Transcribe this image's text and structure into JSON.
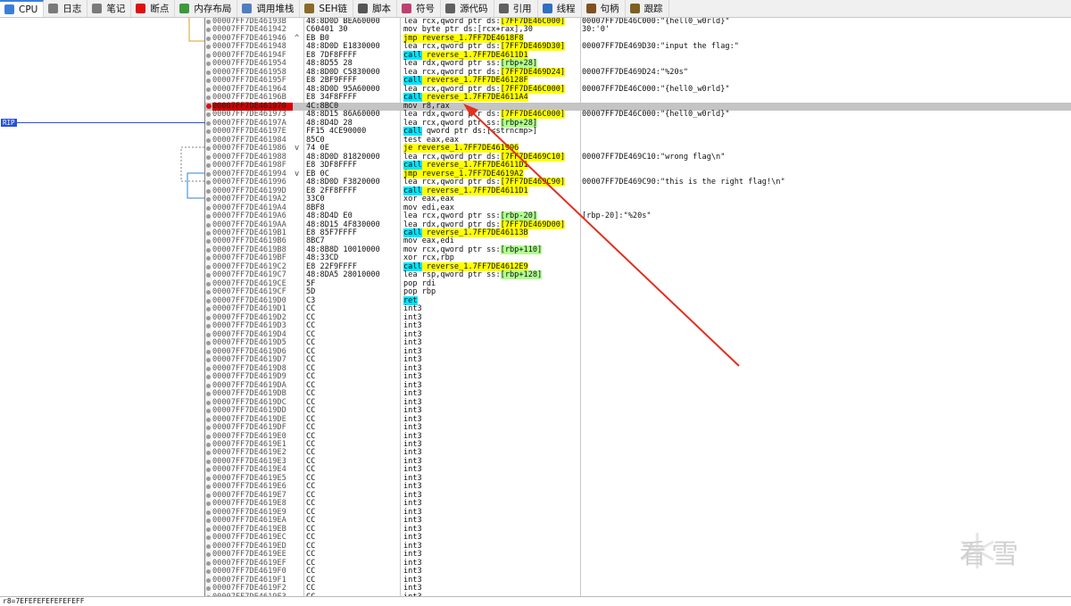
{
  "tabs": [
    {
      "label": "CPU",
      "icon": "cpu-icon",
      "color": "#3c7fd8",
      "active": true
    },
    {
      "label": "日志",
      "icon": "log-icon",
      "color": "#7a7a7a"
    },
    {
      "label": "笔记",
      "icon": "notes-icon",
      "color": "#7a7a7a"
    },
    {
      "label": "断点",
      "icon": "breakpoint-icon",
      "color": "#e01010"
    },
    {
      "label": "内存布局",
      "icon": "memory-map-icon",
      "color": "#3c9a3c"
    },
    {
      "label": "调用堆栈",
      "icon": "call-stack-icon",
      "color": "#4f7fc0"
    },
    {
      "label": "SEH链",
      "icon": "seh-chain-icon",
      "color": "#8a6a2a"
    },
    {
      "label": "脚本",
      "icon": "script-icon",
      "color": "#555555"
    },
    {
      "label": "符号",
      "icon": "symbols-icon",
      "color": "#c04070"
    },
    {
      "label": "源代码",
      "icon": "source-icon",
      "color": "#606060"
    },
    {
      "label": "引用",
      "icon": "references-icon",
      "color": "#606060"
    },
    {
      "label": "线程",
      "icon": "threads-icon",
      "color": "#3070c0"
    },
    {
      "label": "句柄",
      "icon": "handles-icon",
      "color": "#805020"
    },
    {
      "label": "跟踪",
      "icon": "trace-icon",
      "color": "#806020"
    }
  ],
  "rip_label": "RIP",
  "rows": [
    {
      "addr": "00007FF7DE46193B",
      "bytes": "48:8D0D BEA60000",
      "mark": "",
      "instr": [
        [
          "lea rcx,qword ptr ds:",
          ""
        ],
        [
          "[7FF7DE46C000]",
          "y"
        ]
      ],
      "cmt": "00007FF7DE46C000:\"{hell0_w0rld}\""
    },
    {
      "addr": "00007FF7DE461942",
      "bytes": "C60401 30",
      "mark": "",
      "instr": [
        [
          "mov byte ptr ds:[rcx+rax],30",
          ""
        ]
      ],
      "cmt": "30:'0'"
    },
    {
      "addr": "00007FF7DE461946",
      "bytes": "EB B0",
      "mark": "^",
      "instr": [
        [
          "jmp reverse_1.7FF7DE4618F8",
          "y"
        ]
      ],
      "cmt": ""
    },
    {
      "addr": "00007FF7DE461948",
      "bytes": "48:8D0D E1830000",
      "mark": "",
      "instr": [
        [
          "lea rcx,qword ptr ds:",
          ""
        ],
        [
          "[7FF7DE469D30]",
          "y"
        ]
      ],
      "cmt": "00007FF7DE469D30:\"input the flag:\""
    },
    {
      "addr": "00007FF7DE46194F",
      "bytes": "E8 7DF8FFFF",
      "mark": "",
      "instr": [
        [
          "call",
          "c"
        ],
        [
          " reverse_1.7FF7DE4611D1",
          "y"
        ]
      ],
      "cmt": ""
    },
    {
      "addr": "00007FF7DE461954",
      "bytes": "48:8D55 28",
      "mark": "",
      "instr": [
        [
          "lea rdx,qword ptr ss:",
          ""
        ],
        [
          "[rbp+28]",
          "g"
        ]
      ],
      "cmt": ""
    },
    {
      "addr": "00007FF7DE461958",
      "bytes": "48:8D0D C5830000",
      "mark": "",
      "instr": [
        [
          "lea rcx,qword ptr ds:",
          ""
        ],
        [
          "[7FF7DE469D24]",
          "y"
        ]
      ],
      "cmt": "00007FF7DE469D24:\"%20s\""
    },
    {
      "addr": "00007FF7DE46195F",
      "bytes": "E8 2BF9FFFF",
      "mark": "",
      "instr": [
        [
          "call",
          "c"
        ],
        [
          " reverse_1.7FF7DE46128F",
          "y"
        ]
      ],
      "cmt": ""
    },
    {
      "addr": "00007FF7DE461964",
      "bytes": "48:8D0D 95A60000",
      "mark": "",
      "instr": [
        [
          "lea rcx,qword ptr ds:",
          ""
        ],
        [
          "[7FF7DE46C000]",
          "y"
        ]
      ],
      "cmt": "00007FF7DE46C000:\"{hell0_w0rld}\""
    },
    {
      "addr": "00007FF7DE46196B",
      "bytes": "E8 34F8FFFF",
      "mark": "",
      "instr": [
        [
          "call",
          "c"
        ],
        [
          " reverse_1.7FF7DE4611A4",
          "y"
        ]
      ],
      "cmt": ""
    },
    {
      "addr": "00007FF7DE461970",
      "bytes": "4C:8BC0",
      "mark": "",
      "instr": [
        [
          "mov r8,rax",
          ""
        ]
      ],
      "cmt": "",
      "cur": true
    },
    {
      "addr": "00007FF7DE461973",
      "bytes": "48:8D15 86A60000",
      "mark": "",
      "instr": [
        [
          "lea rdx,qword ptr ds:",
          ""
        ],
        [
          "[7FF7DE46C000]",
          "y"
        ]
      ],
      "cmt": "00007FF7DE46C000:\"{hell0_w0rld}\""
    },
    {
      "addr": "00007FF7DE46197A",
      "bytes": "48:8D4D 28",
      "mark": "",
      "instr": [
        [
          "lea rcx,qword ptr ss:",
          ""
        ],
        [
          "[rbp+28]",
          "g"
        ]
      ],
      "cmt": ""
    },
    {
      "addr": "00007FF7DE46197E",
      "bytes": "FF15 4CE90000",
      "mark": "",
      "instr": [
        [
          "call",
          "c"
        ],
        [
          " qword ptr ds:[<strncmp>]",
          ""
        ]
      ],
      "cmt": ""
    },
    {
      "addr": "00007FF7DE461984",
      "bytes": "85C0",
      "mark": "",
      "instr": [
        [
          "test eax,eax",
          ""
        ]
      ],
      "cmt": ""
    },
    {
      "addr": "00007FF7DE461986",
      "bytes": "74 0E",
      "mark": "v",
      "instr": [
        [
          "je reverse_1.7FF7DE461996",
          "y"
        ]
      ],
      "cmt": ""
    },
    {
      "addr": "00007FF7DE461988",
      "bytes": "48:8D0D 81820000",
      "mark": "",
      "instr": [
        [
          "lea rcx,qword ptr ds:",
          ""
        ],
        [
          "[7FF7DE469C10]",
          "y"
        ]
      ],
      "cmt": "00007FF7DE469C10:\"wrong flag\\n\""
    },
    {
      "addr": "00007FF7DE46198F",
      "bytes": "E8 3DF8FFFF",
      "mark": "",
      "instr": [
        [
          "call",
          "c"
        ],
        [
          " reverse_1.7FF7DE4611D1",
          "y"
        ]
      ],
      "cmt": ""
    },
    {
      "addr": "00007FF7DE461994",
      "bytes": "EB 0C",
      "mark": "v",
      "instr": [
        [
          "jmp reverse_1.7FF7DE4619A2",
          "y"
        ]
      ],
      "cmt": ""
    },
    {
      "addr": "00007FF7DE461996",
      "bytes": "48:8D0D F3820000",
      "mark": "",
      "instr": [
        [
          "lea rcx,qword ptr ds:",
          ""
        ],
        [
          "[7FF7DE469C90]",
          "y"
        ]
      ],
      "cmt": "00007FF7DE469C90:\"this is the right flag!\\n\""
    },
    {
      "addr": "00007FF7DE46199D",
      "bytes": "E8 2FF8FFFF",
      "mark": "",
      "instr": [
        [
          "call",
          "c"
        ],
        [
          " reverse_1.7FF7DE4611D1",
          "y"
        ]
      ],
      "cmt": ""
    },
    {
      "addr": "00007FF7DE4619A2",
      "bytes": "33C0",
      "mark": "",
      "instr": [
        [
          "xor eax,eax",
          ""
        ]
      ],
      "cmt": ""
    },
    {
      "addr": "00007FF7DE4619A4",
      "bytes": "8BF8",
      "mark": "",
      "instr": [
        [
          "mov edi,eax",
          ""
        ]
      ],
      "cmt": ""
    },
    {
      "addr": "00007FF7DE4619A6",
      "bytes": "48:8D4D E0",
      "mark": "",
      "instr": [
        [
          "lea rcx,qword ptr ss:",
          ""
        ],
        [
          "[rbp-20]",
          "g"
        ]
      ],
      "cmt": "[rbp-20]:\"%20s\""
    },
    {
      "addr": "00007FF7DE4619AA",
      "bytes": "48:8D15 4F830000",
      "mark": "",
      "instr": [
        [
          "lea rdx,qword ptr ds:",
          ""
        ],
        [
          "[7FF7DE469D00]",
          "y"
        ]
      ],
      "cmt": ""
    },
    {
      "addr": "00007FF7DE4619B1",
      "bytes": "E8 85F7FFFF",
      "mark": "",
      "instr": [
        [
          "call",
          "c"
        ],
        [
          " reverse_1.7FF7DE46113B",
          "y"
        ]
      ],
      "cmt": ""
    },
    {
      "addr": "00007FF7DE4619B6",
      "bytes": "8BC7",
      "mark": "",
      "instr": [
        [
          "mov eax,edi",
          ""
        ]
      ],
      "cmt": ""
    },
    {
      "addr": "00007FF7DE4619B8",
      "bytes": "48:8B8D 10010000",
      "mark": "",
      "instr": [
        [
          "mov rcx,qword ptr ss:",
          ""
        ],
        [
          "[rbp+110]",
          "g"
        ]
      ],
      "cmt": ""
    },
    {
      "addr": "00007FF7DE4619BF",
      "bytes": "48:33CD",
      "mark": "",
      "instr": [
        [
          "xor rcx,rbp",
          ""
        ]
      ],
      "cmt": ""
    },
    {
      "addr": "00007FF7DE4619C2",
      "bytes": "E8 22F9FFFF",
      "mark": "",
      "instr": [
        [
          "call",
          "c"
        ],
        [
          " reverse_1.7FF7DE4612E9",
          "y"
        ]
      ],
      "cmt": ""
    },
    {
      "addr": "00007FF7DE4619C7",
      "bytes": "48:8DA5 28010000",
      "mark": "",
      "instr": [
        [
          "lea rsp,qword ptr ss:",
          ""
        ],
        [
          "[rbp+128]",
          "g"
        ]
      ],
      "cmt": ""
    },
    {
      "addr": "00007FF7DE4619CE",
      "bytes": "5F",
      "mark": "",
      "instr": [
        [
          "pop rdi",
          ""
        ]
      ],
      "cmt": ""
    },
    {
      "addr": "00007FF7DE4619CF",
      "bytes": "5D",
      "mark": "",
      "instr": [
        [
          "pop rbp",
          ""
        ]
      ],
      "cmt": ""
    },
    {
      "addr": "00007FF7DE4619D0",
      "bytes": "C3",
      "mark": "",
      "instr": [
        [
          "ret",
          "c"
        ]
      ],
      "cmt": ""
    },
    {
      "addr": "00007FF7DE4619D1",
      "bytes": "CC",
      "mark": "",
      "instr": [
        [
          "int3",
          ""
        ]
      ],
      "cmt": ""
    },
    {
      "addr": "00007FF7DE4619D2",
      "bytes": "CC",
      "mark": "",
      "instr": [
        [
          "int3",
          ""
        ]
      ],
      "cmt": ""
    },
    {
      "addr": "00007FF7DE4619D3",
      "bytes": "CC",
      "mark": "",
      "instr": [
        [
          "int3",
          ""
        ]
      ],
      "cmt": ""
    },
    {
      "addr": "00007FF7DE4619D4",
      "bytes": "CC",
      "mark": "",
      "instr": [
        [
          "int3",
          ""
        ]
      ],
      "cmt": ""
    },
    {
      "addr": "00007FF7DE4619D5",
      "bytes": "CC",
      "mark": "",
      "instr": [
        [
          "int3",
          ""
        ]
      ],
      "cmt": ""
    },
    {
      "addr": "00007FF7DE4619D6",
      "bytes": "CC",
      "mark": "",
      "instr": [
        [
          "int3",
          ""
        ]
      ],
      "cmt": ""
    },
    {
      "addr": "00007FF7DE4619D7",
      "bytes": "CC",
      "mark": "",
      "instr": [
        [
          "int3",
          ""
        ]
      ],
      "cmt": ""
    },
    {
      "addr": "00007FF7DE4619D8",
      "bytes": "CC",
      "mark": "",
      "instr": [
        [
          "int3",
          ""
        ]
      ],
      "cmt": ""
    },
    {
      "addr": "00007FF7DE4619D9",
      "bytes": "CC",
      "mark": "",
      "instr": [
        [
          "int3",
          ""
        ]
      ],
      "cmt": ""
    },
    {
      "addr": "00007FF7DE4619DA",
      "bytes": "CC",
      "mark": "",
      "instr": [
        [
          "int3",
          ""
        ]
      ],
      "cmt": ""
    },
    {
      "addr": "00007FF7DE4619DB",
      "bytes": "CC",
      "mark": "",
      "instr": [
        [
          "int3",
          ""
        ]
      ],
      "cmt": ""
    },
    {
      "addr": "00007FF7DE4619DC",
      "bytes": "CC",
      "mark": "",
      "instr": [
        [
          "int3",
          ""
        ]
      ],
      "cmt": ""
    },
    {
      "addr": "00007FF7DE4619DD",
      "bytes": "CC",
      "mark": "",
      "instr": [
        [
          "int3",
          ""
        ]
      ],
      "cmt": ""
    },
    {
      "addr": "00007FF7DE4619DE",
      "bytes": "CC",
      "mark": "",
      "instr": [
        [
          "int3",
          ""
        ]
      ],
      "cmt": ""
    },
    {
      "addr": "00007FF7DE4619DF",
      "bytes": "CC",
      "mark": "",
      "instr": [
        [
          "int3",
          ""
        ]
      ],
      "cmt": ""
    },
    {
      "addr": "00007FF7DE4619E0",
      "bytes": "CC",
      "mark": "",
      "instr": [
        [
          "int3",
          ""
        ]
      ],
      "cmt": ""
    },
    {
      "addr": "00007FF7DE4619E1",
      "bytes": "CC",
      "mark": "",
      "instr": [
        [
          "int3",
          ""
        ]
      ],
      "cmt": ""
    },
    {
      "addr": "00007FF7DE4619E2",
      "bytes": "CC",
      "mark": "",
      "instr": [
        [
          "int3",
          ""
        ]
      ],
      "cmt": ""
    },
    {
      "addr": "00007FF7DE4619E3",
      "bytes": "CC",
      "mark": "",
      "instr": [
        [
          "int3",
          ""
        ]
      ],
      "cmt": ""
    },
    {
      "addr": "00007FF7DE4619E4",
      "bytes": "CC",
      "mark": "",
      "instr": [
        [
          "int3",
          ""
        ]
      ],
      "cmt": ""
    },
    {
      "addr": "00007FF7DE4619E5",
      "bytes": "CC",
      "mark": "",
      "instr": [
        [
          "int3",
          ""
        ]
      ],
      "cmt": ""
    },
    {
      "addr": "00007FF7DE4619E6",
      "bytes": "CC",
      "mark": "",
      "instr": [
        [
          "int3",
          ""
        ]
      ],
      "cmt": ""
    },
    {
      "addr": "00007FF7DE4619E7",
      "bytes": "CC",
      "mark": "",
      "instr": [
        [
          "int3",
          ""
        ]
      ],
      "cmt": ""
    },
    {
      "addr": "00007FF7DE4619E8",
      "bytes": "CC",
      "mark": "",
      "instr": [
        [
          "int3",
          ""
        ]
      ],
      "cmt": ""
    },
    {
      "addr": "00007FF7DE4619E9",
      "bytes": "CC",
      "mark": "",
      "instr": [
        [
          "int3",
          ""
        ]
      ],
      "cmt": ""
    },
    {
      "addr": "00007FF7DE4619EA",
      "bytes": "CC",
      "mark": "",
      "instr": [
        [
          "int3",
          ""
        ]
      ],
      "cmt": ""
    },
    {
      "addr": "00007FF7DE4619EB",
      "bytes": "CC",
      "mark": "",
      "instr": [
        [
          "int3",
          ""
        ]
      ],
      "cmt": ""
    },
    {
      "addr": "00007FF7DE4619EC",
      "bytes": "CC",
      "mark": "",
      "instr": [
        [
          "int3",
          ""
        ]
      ],
      "cmt": ""
    },
    {
      "addr": "00007FF7DE4619ED",
      "bytes": "CC",
      "mark": "",
      "instr": [
        [
          "int3",
          ""
        ]
      ],
      "cmt": ""
    },
    {
      "addr": "00007FF7DE4619EE",
      "bytes": "CC",
      "mark": "",
      "instr": [
        [
          "int3",
          ""
        ]
      ],
      "cmt": ""
    },
    {
      "addr": "00007FF7DE4619EF",
      "bytes": "CC",
      "mark": "",
      "instr": [
        [
          "int3",
          ""
        ]
      ],
      "cmt": ""
    },
    {
      "addr": "00007FF7DE4619F0",
      "bytes": "CC",
      "mark": "",
      "instr": [
        [
          "int3",
          ""
        ]
      ],
      "cmt": ""
    },
    {
      "addr": "00007FF7DE4619F1",
      "bytes": "CC",
      "mark": "",
      "instr": [
        [
          "int3",
          ""
        ]
      ],
      "cmt": ""
    },
    {
      "addr": "00007FF7DE4619F2",
      "bytes": "CC",
      "mark": "",
      "instr": [
        [
          "int3",
          ""
        ]
      ],
      "cmt": ""
    },
    {
      "addr": "00007FF7DE4619F3",
      "bytes": "CC",
      "mark": "",
      "instr": [
        [
          "int3",
          ""
        ]
      ],
      "cmt": ""
    }
  ],
  "status_text": "r8=7EFEFEFEFEFEFEFF",
  "watermark_text": "看雪"
}
